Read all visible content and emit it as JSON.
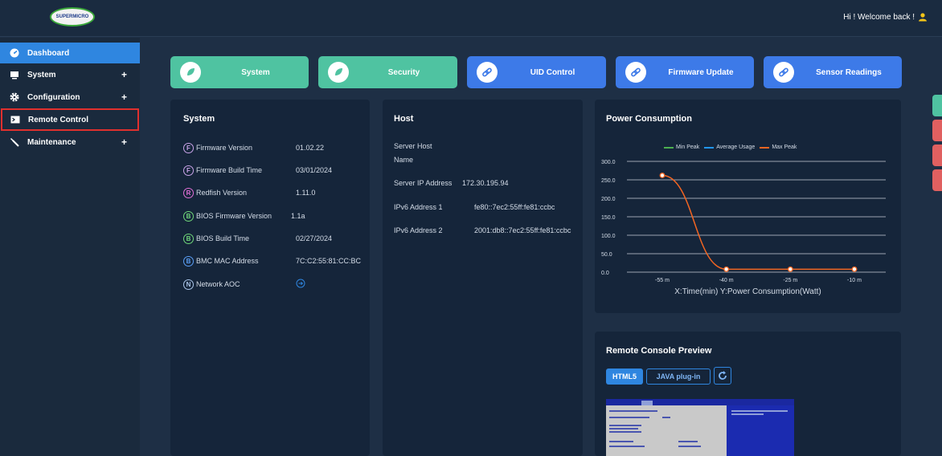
{
  "header": {
    "logo_text": "SUPERMICRO",
    "welcome": "Hi ! Welcome back !"
  },
  "sidebar": {
    "items": [
      {
        "label": "Dashboard",
        "icon": "dashboard-icon",
        "active": true,
        "expandable": false
      },
      {
        "label": "System",
        "icon": "monitor-icon",
        "active": false,
        "expandable": true
      },
      {
        "label": "Configuration",
        "icon": "gear-icon",
        "active": false,
        "expandable": true
      },
      {
        "label": "Remote Control",
        "icon": "console-icon",
        "active": false,
        "expandable": false,
        "highlighted": true
      },
      {
        "label": "Maintenance",
        "icon": "wrench-icon",
        "active": false,
        "expandable": true
      }
    ],
    "plus": "+"
  },
  "tabs": [
    {
      "label": "System",
      "color": "#4fc3a1"
    },
    {
      "label": "Security",
      "color": "#4fc3a1"
    },
    {
      "label": "UID Control",
      "color": "#3d7ae8"
    },
    {
      "label": "Firmware Update",
      "color": "#3d7ae8"
    },
    {
      "label": "Sensor Readings",
      "color": "#3d7ae8"
    }
  ],
  "system_card": {
    "title": "System",
    "rows": [
      {
        "badge": "F",
        "label": "Firmware Version",
        "value": "01.02.22",
        "color": "#c9a3e8"
      },
      {
        "badge": "F",
        "label": "Firmware Build Time",
        "value": "03/01/2024",
        "color": "#c9a3e8"
      },
      {
        "badge": "R",
        "label": "Redfish Version",
        "value": "1.11.0",
        "color": "#e06fd6"
      },
      {
        "badge": "B",
        "label": "BIOS Firmware Version",
        "value": "1.1a",
        "color": "#6fd67a"
      },
      {
        "badge": "B",
        "label": "BIOS Build Time",
        "value": "02/27/2024",
        "color": "#6fd67a"
      },
      {
        "badge": "B",
        "label": "BMC MAC Address",
        "value": "7C:C2:55:81:CC:BC",
        "color": "#5a9ef5"
      },
      {
        "badge": "N",
        "label": "Network AOC",
        "value": "",
        "color": "#a9c4e8"
      }
    ]
  },
  "host_card": {
    "title": "Host",
    "rows": [
      {
        "label": "Server Host",
        "value": ""
      },
      {
        "label": "Name",
        "value": ""
      },
      {
        "label": "Server IP Address",
        "value": "172.30.195.94"
      },
      {
        "label": "IPv6 Address 1",
        "value": "fe80::7ec2:55ff:fe81:ccbc"
      },
      {
        "label": "IPv6 Address 2",
        "value": "2001:db8::7ec2:55ff:fe81:ccbc"
      }
    ]
  },
  "power_card": {
    "title": "Power Consumption",
    "caption": "X:Time(min) Y:Power Consumption(Watt)"
  },
  "chart_data": {
    "type": "line",
    "title": "Power Consumption",
    "xlabel": "X:Time(min) Y:Power Consumption(Watt)",
    "ylabel": "",
    "x": [
      "-55 m",
      "-40 m",
      "-25 m",
      "-10 m"
    ],
    "yticks": [
      "0.0",
      "50.0",
      "100.0",
      "150.0",
      "200.0",
      "250.0",
      "300.0"
    ],
    "ylim": [
      0,
      300
    ],
    "legend": [
      "Min Peak",
      "Average Usage",
      "Max Peak"
    ],
    "legend_colors": [
      "#4caf50",
      "#2196f3",
      "#f26522"
    ],
    "legend_position": "top",
    "series": [
      {
        "name": "Max Peak",
        "color": "#f26522",
        "values": [
          262,
          8,
          8,
          8
        ]
      }
    ]
  },
  "console_card": {
    "title": "Remote Console Preview",
    "html5": "HTML5",
    "java": "JAVA plug-in"
  }
}
